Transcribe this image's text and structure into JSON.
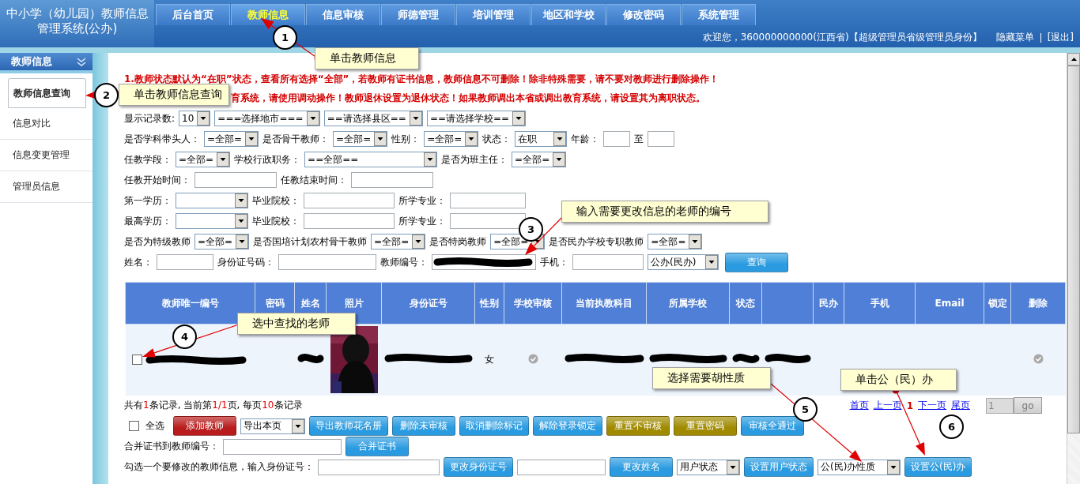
{
  "header": {
    "title": [
      "中小学（幼儿园）教师信息",
      "管理系统(公办)"
    ],
    "tabs": [
      {
        "label": "后台首页",
        "selected": false
      },
      {
        "label": "教师信息",
        "selected": true
      },
      {
        "label": "信息审核",
        "selected": false
      },
      {
        "label": "师德管理",
        "selected": false
      },
      {
        "label": "培训管理",
        "selected": false
      },
      {
        "label": "地区和学校",
        "selected": false
      },
      {
        "label": "修改密码",
        "selected": false
      },
      {
        "label": "系统管理",
        "selected": false
      }
    ],
    "welcome": "欢迎您，360000000000(江西省)【超级管理员省级管理员身份】",
    "links": [
      "隐藏菜单",
      "[退出]"
    ]
  },
  "sidebar": {
    "title": "教师信息",
    "items": [
      {
        "label": "教师信息查询",
        "selected": true
      },
      {
        "label": "信息对比",
        "selected": false
      },
      {
        "label": "信息变更管理",
        "selected": false
      },
      {
        "label": "管理员信息",
        "selected": false
      }
    ]
  },
  "notices": [
    "1.教师状态默认为“在职”状态，查看所有选择“全部”，若教师有证书信息，教师信息不可删除！除非特殊需要，请不要对教师进行删除操作！",
    "育系统，请使用调动操作！教师退休设置为退休状态！如果教师调出本省或调出教育系统，请设置其为离职状态。"
  ],
  "filters": [
    [
      {
        "kind": "label",
        "text": "显示记录数:"
      },
      {
        "kind": "select",
        "value": "10"
      },
      {
        "kind": "select",
        "value": "===选择地市==="
      },
      {
        "kind": "select",
        "value": "==请选择县区=="
      },
      {
        "kind": "select",
        "value": "==请选择学校=="
      }
    ],
    [
      {
        "kind": "label",
        "text": "是否学科带头人："
      },
      {
        "kind": "select",
        "value": "=全部="
      },
      {
        "kind": "label",
        "text": "是否骨干教师："
      },
      {
        "kind": "select",
        "value": "=全部="
      },
      {
        "kind": "label",
        "text": "性别："
      },
      {
        "kind": "select",
        "value": "=全部="
      },
      {
        "kind": "label",
        "text": "状态："
      },
      {
        "kind": "select",
        "value": "在职"
      },
      {
        "kind": "label",
        "text": "年龄："
      },
      {
        "kind": "input"
      },
      {
        "kind": "label",
        "text": "至"
      },
      {
        "kind": "input"
      }
    ],
    [
      {
        "kind": "label",
        "text": "任教学段："
      },
      {
        "kind": "select",
        "value": "=全部="
      },
      {
        "kind": "label",
        "text": "学校行政职务："
      },
      {
        "kind": "select",
        "value": "==全部=="
      },
      {
        "kind": "label",
        "text": "是否为班主任："
      },
      {
        "kind": "select",
        "value": "=全部="
      }
    ],
    [
      {
        "kind": "label",
        "text": "任教开始时间："
      },
      {
        "kind": "input"
      },
      {
        "kind": "label",
        "text": "任教结束时间："
      },
      {
        "kind": "input"
      }
    ],
    [
      {
        "kind": "label",
        "text": "第一学历："
      },
      {
        "kind": "select"
      },
      {
        "kind": "label",
        "text": "毕业院校："
      },
      {
        "kind": "input"
      },
      {
        "kind": "label",
        "text": "所学专业："
      },
      {
        "kind": "input"
      }
    ],
    [
      {
        "kind": "label",
        "text": "最高学历："
      },
      {
        "kind": "select"
      },
      {
        "kind": "label",
        "text": "毕业院校："
      },
      {
        "kind": "input"
      },
      {
        "kind": "label",
        "text": "所学专业："
      },
      {
        "kind": "input"
      }
    ],
    [
      {
        "kind": "label",
        "text": "是否为特级教师"
      },
      {
        "kind": "select",
        "value": "=全部="
      },
      {
        "kind": "label",
        "text": "是否国培计划农村骨干教师"
      },
      {
        "kind": "select",
        "value": "=全部="
      },
      {
        "kind": "label",
        "text": "是否特岗教师"
      },
      {
        "kind": "select",
        "value": "=全部="
      },
      {
        "kind": "label",
        "text": "是否民办学校专职教师"
      },
      {
        "kind": "select",
        "value": "=全部="
      }
    ],
    [
      {
        "kind": "label",
        "text": "姓名："
      },
      {
        "kind": "input"
      },
      {
        "kind": "label",
        "text": "身份证号码："
      },
      {
        "kind": "input"
      },
      {
        "kind": "label",
        "text": "教师编号："
      },
      {
        "kind": "input",
        "redacted": true
      },
      {
        "kind": "label",
        "text": "手机："
      },
      {
        "kind": "input"
      },
      {
        "kind": "select",
        "value": "公办(民办)"
      },
      {
        "kind": "button",
        "text": "查询"
      }
    ]
  ],
  "table": {
    "columns": [
      "教师唯一编号",
      "密码",
      "姓名",
      "照片",
      "身份证号",
      "性别",
      "学校审核",
      "当前执教科目",
      "所属学校",
      "状态",
      "",
      "民办",
      "手机",
      "Email",
      "锁定",
      "删除"
    ],
    "rows": [
      {
        "checked": false,
        "cells": [
          {
            "kind": "redacted"
          },
          {
            "kind": "empty"
          },
          {
            "kind": "redacted"
          },
          {
            "kind": "picture"
          },
          {
            "kind": "redacted"
          },
          {
            "kind": "text",
            "text": "女"
          },
          {
            "kind": "check"
          },
          {
            "kind": "redacted"
          },
          {
            "kind": "redacted"
          },
          {
            "kind": "redacted"
          },
          {
            "kind": "redacted"
          },
          {
            "kind": "empty"
          },
          {
            "kind": "empty"
          },
          {
            "kind": "empty"
          },
          {
            "kind": "empty"
          },
          {
            "kind": "check"
          }
        ]
      }
    ]
  },
  "footer": {
    "summary": [
      {
        "text": "共有",
        "highlight": false
      },
      {
        "text": "1",
        "highlight": true
      },
      {
        "text": "条记录, 当前第",
        "highlight": false
      },
      {
        "text": "1/1",
        "highlight": true
      },
      {
        "text": "页, 每页",
        "highlight": false
      },
      {
        "text": "10",
        "highlight": true
      },
      {
        "text": "条记录",
        "highlight": false
      }
    ],
    "pager": {
      "links": [
        "首页",
        "上一页"
      ],
      "current": "1",
      "next_links": [
        "下一页",
        "尾页"
      ],
      "page_input": "1",
      "go": "go",
      "disabled": true
    },
    "bars": [
      {
        "items": [
          {
            "kind": "checkbox",
            "text": "全选",
            "checked": false
          },
          {
            "kind": "button",
            "text": "添加教师",
            "color": "#b81c1c"
          },
          {
            "kind": "select",
            "value": "导出本页"
          },
          {
            "kind": "button",
            "text": "导出教师花名册",
            "color": "#2a9be0"
          },
          {
            "kind": "button",
            "text": "删除未审核",
            "color": "#2a9be0"
          },
          {
            "kind": "button",
            "text": "取消删除标记",
            "color": "#2a9be0"
          },
          {
            "kind": "button",
            "text": "解除登录锁定",
            "color": "#2a9be0"
          },
          {
            "kind": "button",
            "text": "重置不审核",
            "color": "#a08a00"
          },
          {
            "kind": "button",
            "text": "重置密码",
            "color": "#a08a00"
          },
          {
            "kind": "button",
            "text": "审核全通过",
            "color": "#2a9be0"
          }
        ]
      },
      {
        "items": [
          {
            "kind": "label",
            "text": "合并证书到教师编号："
          },
          {
            "kind": "input"
          },
          {
            "kind": "button",
            "text": "合并证书",
            "color": "#2a9be0"
          }
        ]
      },
      {
        "items": [
          {
            "kind": "label",
            "text": "勾选一个要修改的教师信息，输入身份证号："
          },
          {
            "kind": "input"
          },
          {
            "kind": "button",
            "text": "更改身份证号",
            "color": "#2a9be0"
          },
          {
            "kind": "input"
          },
          {
            "kind": "button",
            "text": "更改姓名",
            "color": "#2a9be0"
          },
          {
            "kind": "select",
            "value": "用户状态"
          },
          {
            "kind": "button",
            "text": "设置用户状态",
            "color": "#2a9be0"
          },
          {
            "kind": "select",
            "value": "公(民)办性质"
          },
          {
            "kind": "button",
            "text": "设置公(民)办",
            "color": "#2a9be0"
          }
        ]
      }
    ]
  },
  "callouts": [
    {
      "number": "1",
      "text": "单击教师信息"
    },
    {
      "number": "2",
      "text": "单击教师信息查询"
    },
    {
      "number": "3",
      "text": "输入需要更改信息的老师的编号"
    },
    {
      "number": "4",
      "text": "选中查找的老师"
    },
    {
      "number": "5",
      "text": "选择需要胡性质"
    },
    {
      "number": "6",
      "text": "单击公（民）办"
    }
  ]
}
